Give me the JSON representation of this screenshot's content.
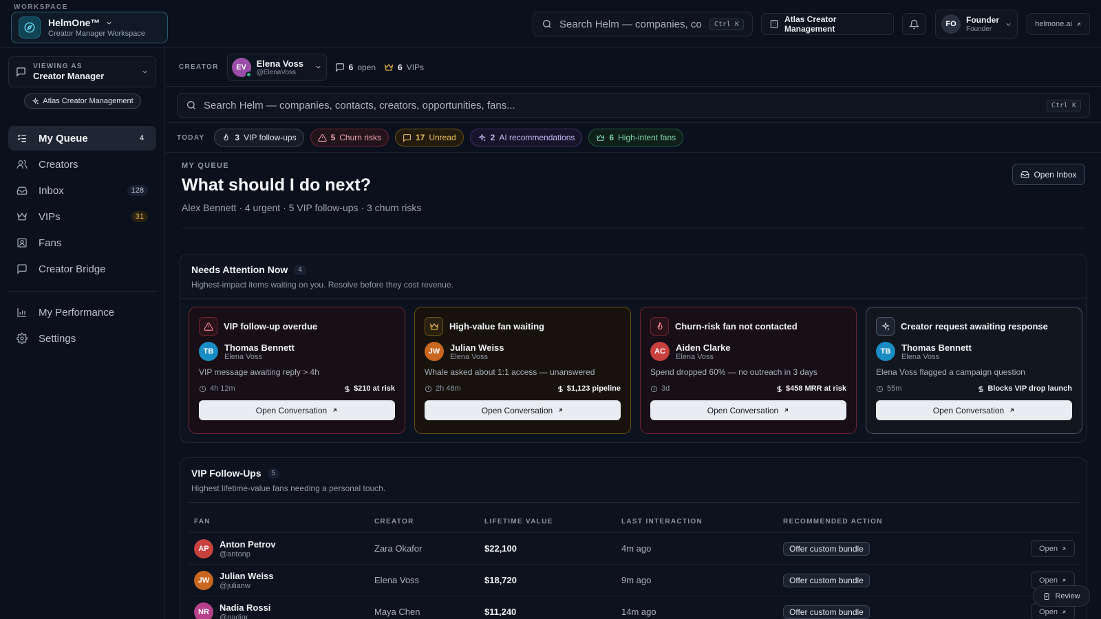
{
  "workspace": {
    "caption": "WORKSPACE",
    "name": "HelmOne™",
    "subtitle": "Creator Manager Workspace"
  },
  "topbar": {
    "search_placeholder": "Search Helm — companies, co...",
    "search_shortcut": "Ctrl K",
    "org_name": "Atlas Creator Management",
    "user": {
      "initials": "FO",
      "name": "Founder",
      "role": "Founder"
    },
    "site_link": "helmone.ai"
  },
  "sidebar": {
    "viewing_as_caption": "VIEWING AS",
    "viewing_as_value": "Creator Manager",
    "org_pill": "Atlas Creator Management",
    "items": [
      {
        "label": "My Queue",
        "badge": "4",
        "icon": "list-check-icon"
      },
      {
        "label": "Creators",
        "badge": "",
        "icon": "users-icon"
      },
      {
        "label": "Inbox",
        "badge": "128",
        "icon": "inbox-icon"
      },
      {
        "label": "VIPs",
        "badge": "31",
        "icon": "crown-icon"
      },
      {
        "label": "Fans",
        "badge": "",
        "icon": "contact-icon"
      },
      {
        "label": "Creator Bridge",
        "badge": "",
        "icon": "message-icon"
      }
    ],
    "secondary_items": [
      {
        "label": "My Performance",
        "icon": "bar-chart-icon"
      },
      {
        "label": "Settings",
        "icon": "gear-icon"
      }
    ]
  },
  "creator_bar": {
    "caption": "CREATOR",
    "creator": {
      "initials": "EV",
      "name": "Elena Voss",
      "handle": "@ElenaVoss"
    },
    "open_count": "6",
    "open_label": "open",
    "vip_count": "6",
    "vip_label": "VIPs"
  },
  "main_search": {
    "placeholder": "Search Helm — companies, contacts, creators, opportunities, fans...",
    "shortcut": "Ctrl K"
  },
  "today": {
    "caption": "TODAY",
    "chips": [
      {
        "count": "3",
        "label": "VIP follow-ups"
      },
      {
        "count": "5",
        "label": "Churn risks"
      },
      {
        "count": "17",
        "label": "Unread"
      },
      {
        "count": "2",
        "label": "AI recommendations"
      },
      {
        "count": "6",
        "label": "High-intent fans"
      }
    ]
  },
  "queue": {
    "caption": "MY QUEUE",
    "title": "What should I do next?",
    "subtitle": "Alex Bennett · 4 urgent · 5 VIP follow-ups · 3 churn risks",
    "open_inbox_label": "Open Inbox"
  },
  "attention": {
    "title": "Needs Attention Now",
    "count": "4",
    "subtitle": "Highest-impact items waiting on you. Resolve before they cost revenue.",
    "cards": [
      {
        "title": "VIP follow-up overdue",
        "person_initials": "TB",
        "person_name": "Thomas Bennett",
        "person_creator": "Elena Voss",
        "description": "VIP message awaiting reply > 4h",
        "time": "4h 12m",
        "impact": "$210 at risk",
        "button": "Open Conversation"
      },
      {
        "title": "High-value fan waiting",
        "person_initials": "JW",
        "person_name": "Julian Weiss",
        "person_creator": "Elena Voss",
        "description": "Whale asked about 1:1 access — unanswered",
        "time": "2h 48m",
        "impact": "$1,123 pipeline",
        "button": "Open Conversation"
      },
      {
        "title": "Churn-risk fan not contacted",
        "person_initials": "AC",
        "person_name": "Aiden Clarke",
        "person_creator": "Elena Voss",
        "description": "Spend dropped 60% — no outreach in 3 days",
        "time": "3d",
        "impact": "$458 MRR at risk",
        "button": "Open Conversation"
      },
      {
        "title": "Creator request awaiting response",
        "person_initials": "TB",
        "person_name": "Thomas Bennett",
        "person_creator": "Elena Voss",
        "description": "Elena Voss flagged a campaign question",
        "time": "55m",
        "impact": "Blocks VIP drop launch",
        "button": "Open Conversation"
      }
    ]
  },
  "vip": {
    "title": "VIP Follow-Ups",
    "count": "5",
    "subtitle": "Highest lifetime-value fans needing a personal touch.",
    "columns": [
      "FAN",
      "CREATOR",
      "LIFETIME VALUE",
      "LAST INTERACTION",
      "RECOMMENDED ACTION"
    ],
    "rows": [
      {
        "initials": "AP",
        "name": "Anton Petrov",
        "handle": "@antonp",
        "creator": "Zara Okafor",
        "ltv": "$22,100",
        "last": "4m ago",
        "action": "Offer custom bundle",
        "open": "Open"
      },
      {
        "initials": "JW",
        "name": "Julian Weiss",
        "handle": "@julianw",
        "creator": "Elena Voss",
        "ltv": "$18,720",
        "last": "9m ago",
        "action": "Offer custom bundle",
        "open": "Open"
      },
      {
        "initials": "NR",
        "name": "Nadia Rossi",
        "handle": "@nadiar",
        "creator": "Maya Chen",
        "ltv": "$11,240",
        "last": "14m ago",
        "action": "Offer custom bundle",
        "open": "Open"
      }
    ]
  },
  "review_button": "Review"
}
